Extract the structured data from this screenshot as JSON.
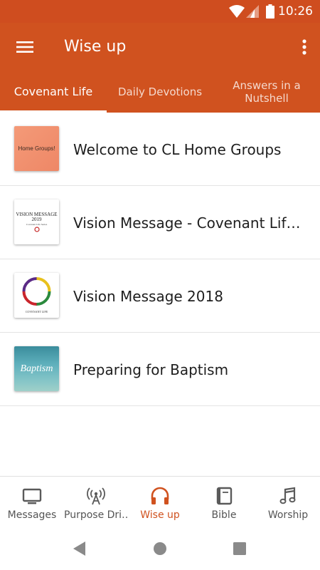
{
  "status": {
    "time": "10:26"
  },
  "appbar": {
    "title": "Wise up"
  },
  "tabs": [
    {
      "label": "Covenant Life"
    },
    {
      "label": "Daily Devotions"
    },
    {
      "label": "Answers in a Nutshell"
    }
  ],
  "items": [
    {
      "title": "Welcome to CL Home Groups",
      "thumb_text": "Home Groups!"
    },
    {
      "title": "Vision Message - Covenant Life…",
      "thumb_text": "VISION MESSAGE 2019",
      "thumb_sub": "Covenant Life Series"
    },
    {
      "title": "Vision Message 2018",
      "thumb_text": "COVENANT LIFE"
    },
    {
      "title": "Preparing for Baptism",
      "thumb_text": "Baptism"
    }
  ],
  "bottom_nav": [
    {
      "label": "Messages",
      "icon": "tv-icon"
    },
    {
      "label": "Purpose Dri…",
      "icon": "broadcast-icon"
    },
    {
      "label": "Wise up",
      "icon": "headphones-icon"
    },
    {
      "label": "Bible",
      "icon": "book-icon"
    },
    {
      "label": "Worship",
      "icon": "music-note-icon"
    }
  ],
  "colors": {
    "primary": "#d0521f",
    "status_bar": "#cf4d1f",
    "active_nav": "#d0521f"
  }
}
